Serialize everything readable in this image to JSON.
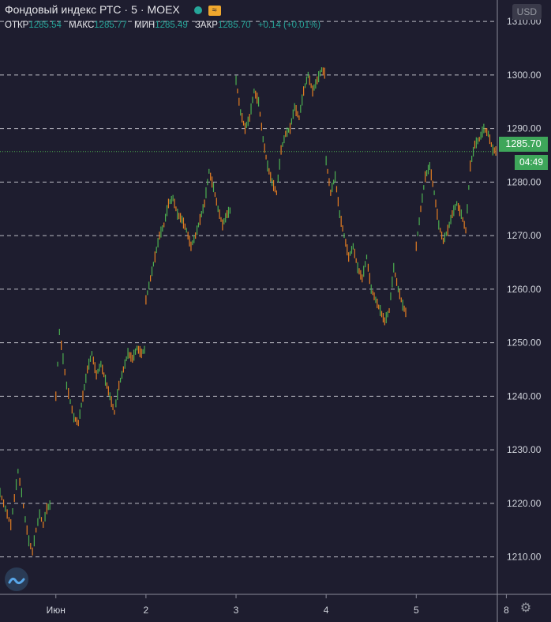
{
  "header": {
    "title": "Фондовый индекс РТС",
    "interval": "5",
    "exchange": "MOEX",
    "currency": "USD",
    "wave_icon": "≈"
  },
  "ohlc": {
    "open_label": "ОТКР",
    "open": "1285.54",
    "high_label": "МАКС",
    "high": "1285.77",
    "low_label": "МИН",
    "low": "1285.49",
    "close_label": "ЗАКР",
    "close": "1285.70",
    "change": "+0.14 (+0.01%)"
  },
  "last_price_label": "1285.70",
  "countdown": "04:49",
  "colors": {
    "background": "#1e1d2f",
    "up": "#4caf50",
    "down": "#e67e22",
    "accent": "#3ea65a"
  },
  "icons": [
    "status-dot-icon",
    "wave-icon",
    "logo-icon",
    "gear-icon"
  ],
  "chart_data": {
    "type": "candlestick",
    "title": "Фондовый индекс РТС",
    "ylim": [
      1203,
      1314
    ],
    "y_ticks": [
      "1210.00",
      "1220.00",
      "1230.00",
      "1240.00",
      "1250.00",
      "1260.00",
      "1270.00",
      "1280.00",
      "1290.00",
      "1300.00",
      "1310.00"
    ],
    "x_ticks": [
      "Июн",
      "2",
      "3",
      "4",
      "5",
      "8"
    ],
    "x_tick_positions": [
      0.5,
      1.5,
      2.5,
      3.5,
      4.5,
      5.5
    ],
    "xlim": [
      -0.12,
      5.4
    ],
    "last_price": 1285.7,
    "series": [
      {
        "x": [
          -0.12,
          -0.06,
          0.0,
          0.04,
          0.08,
          0.12,
          0.16,
          0.2,
          0.24,
          0.28,
          0.32,
          0.36,
          0.4,
          0.45
        ],
        "y": [
          1222,
          1219,
          1216,
          1221,
          1226,
          1222,
          1217,
          1213,
          1211,
          1215,
          1218,
          1216,
          1219,
          1220
        ]
      },
      {
        "x": [
          0.5,
          0.54,
          0.58,
          0.62,
          0.66,
          0.7,
          0.75,
          0.8,
          0.85,
          0.9,
          0.95,
          1.0,
          1.05,
          1.1,
          1.15,
          1.2,
          1.25,
          1.3,
          1.35,
          1.4,
          1.45,
          1.5
        ],
        "y": [
          1240,
          1252,
          1247,
          1242,
          1239,
          1236,
          1235,
          1240,
          1245,
          1248,
          1244,
          1246,
          1243,
          1240,
          1237,
          1242,
          1245,
          1248,
          1247,
          1249,
          1248,
          1249
        ]
      },
      {
        "x": [
          1.5,
          1.55,
          1.6,
          1.65,
          1.7,
          1.75,
          1.8,
          1.85,
          1.9,
          1.95,
          2.0,
          2.05,
          2.1,
          2.15,
          2.2,
          2.25,
          2.3,
          2.35,
          2.4,
          2.45
        ],
        "y": [
          1258,
          1262,
          1266,
          1270,
          1272,
          1276,
          1277,
          1274,
          1273,
          1271,
          1268,
          1270,
          1273,
          1276,
          1282,
          1279,
          1275,
          1272,
          1274,
          1275
        ]
      },
      {
        "x": [
          2.5,
          2.55,
          2.6,
          2.65,
          2.7,
          2.75,
          2.8,
          2.85,
          2.9,
          2.95,
          3.0,
          3.05,
          3.1,
          3.15,
          3.2,
          3.25,
          3.3,
          3.35,
          3.4,
          3.45,
          3.5
        ],
        "y": [
          1299,
          1293,
          1290,
          1292,
          1297,
          1295,
          1288,
          1283,
          1280,
          1278,
          1286,
          1289,
          1290,
          1294,
          1292,
          1297,
          1300,
          1297,
          1299,
          1301,
          1300
        ]
      },
      {
        "x": [
          3.5,
          3.55,
          3.6,
          3.65,
          3.7,
          3.75,
          3.8,
          3.85,
          3.9,
          3.95,
          4.0,
          4.05,
          4.1,
          4.15,
          4.2,
          4.25,
          4.3,
          4.35,
          4.4
        ],
        "y": [
          1284,
          1278,
          1281,
          1274,
          1270,
          1266,
          1268,
          1264,
          1262,
          1266,
          1260,
          1258,
          1256,
          1254,
          1256,
          1264,
          1260,
          1257,
          1255
        ]
      },
      {
        "x": [
          4.5,
          4.55,
          4.6,
          4.65,
          4.7,
          4.75,
          4.8,
          4.85,
          4.9,
          4.95,
          5.0,
          5.05,
          5.1,
          5.15,
          5.2,
          5.25,
          5.3,
          5.35,
          5.4
        ],
        "y": [
          1268,
          1275,
          1281,
          1283,
          1278,
          1272,
          1269,
          1271,
          1274,
          1276,
          1274,
          1271,
          1283,
          1287,
          1288,
          1290,
          1289,
          1286,
          1285.7
        ]
      }
    ]
  }
}
